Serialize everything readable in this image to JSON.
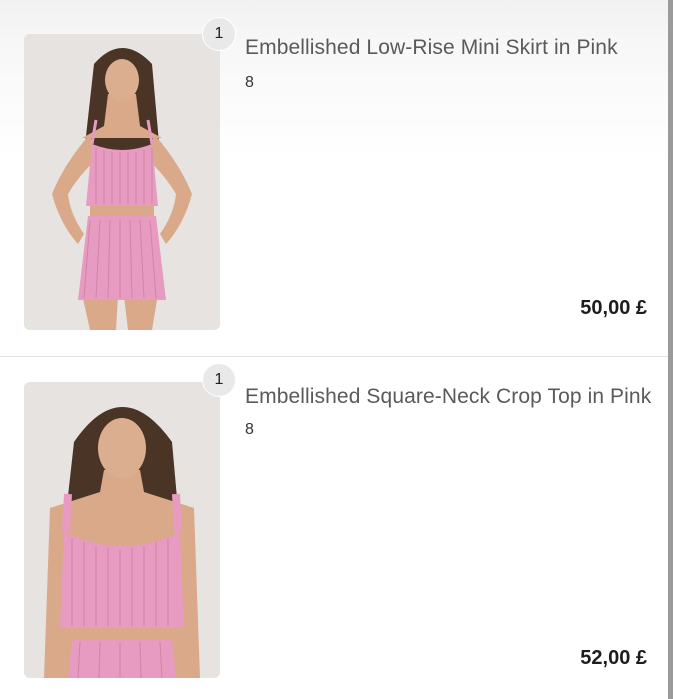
{
  "cart": {
    "items": [
      {
        "quantity": "1",
        "title": "Embellished Low-Rise Mini Skirt in Pink",
        "size": "8",
        "price": "50,00 £",
        "image": "product-photo-pink-skirt-set"
      },
      {
        "quantity": "1",
        "title": "Embellished Square-Neck Crop Top in Pink",
        "size": "8",
        "price": "52,00 £",
        "image": "product-photo-pink-crop-top"
      }
    ]
  },
  "colors": {
    "product_pink": "#e79bc0",
    "thumb_background": "#e6e3e0",
    "hair": "#4a3426",
    "skin": "#d9a98a"
  }
}
